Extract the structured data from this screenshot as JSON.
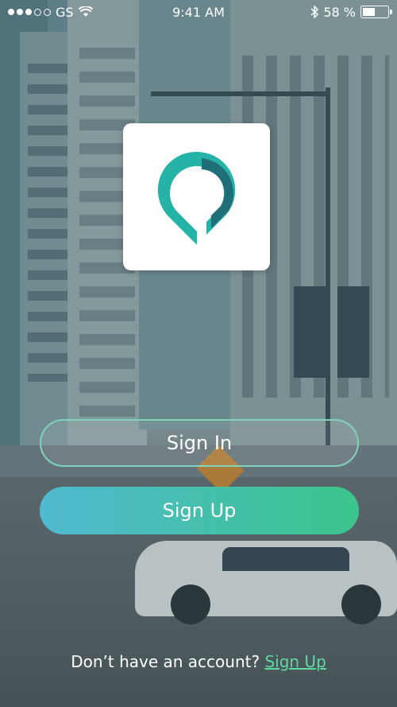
{
  "status_bar": {
    "carrier": "GS",
    "time": "9:41 AM",
    "battery": "58 %",
    "battery_level": 0.58
  },
  "logo": {
    "icon": "map-pin-logo-icon"
  },
  "buttons": {
    "sign_in": "Sign In",
    "sign_up": "Sign Up"
  },
  "footer": {
    "prompt": "Don’t have an account?",
    "link": "Sign Up"
  },
  "colors": {
    "accent_teal": "#26b3a7",
    "accent_dark": "#1f6e78",
    "button_gradient_start": "#4fb9cf",
    "button_gradient_end": "#3cc58c",
    "link": "#5fd8a2"
  }
}
